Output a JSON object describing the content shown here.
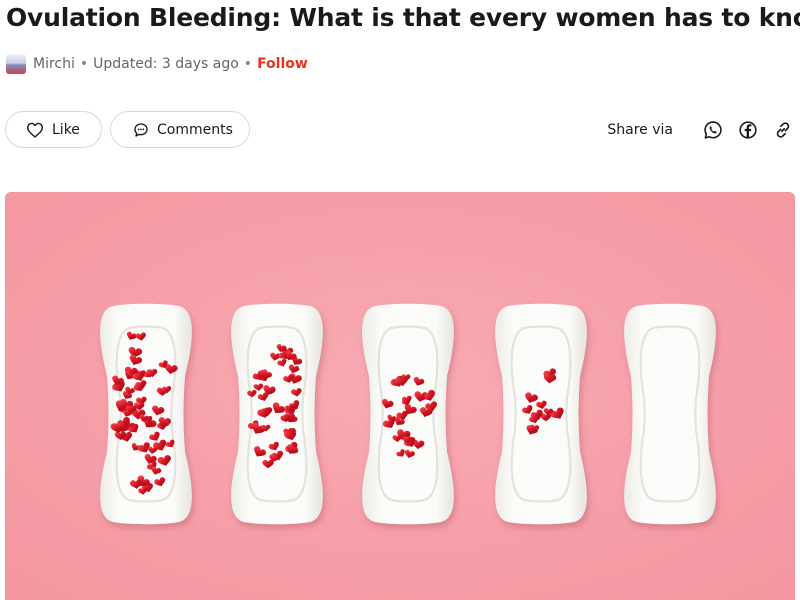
{
  "article": {
    "title": "Ovulation Bleeding: What is that every women has to know",
    "meta": {
      "author": "Mirchi",
      "separator": "•",
      "updated": "Updated: 3 days ago",
      "follow_label": "Follow"
    }
  },
  "actions": {
    "like_label": "Like",
    "comments_label": "Comments",
    "share_label": "Share via",
    "share_icons": [
      "whatsapp-icon",
      "facebook-icon",
      "link-icon"
    ]
  },
  "hero_image": {
    "subject": "five sanitary pads with decreasing amounts of red heart confetti on a pink background",
    "pad_count": 5,
    "hearts_per_pad": [
      60,
      42,
      24,
      12,
      0
    ],
    "background_color": "#f7a2ab",
    "pad_color": "#f9f9f7",
    "heart_color": "#c4101c"
  },
  "colors": {
    "accent": "#e8331f",
    "text": "#1a1a1a",
    "muted": "#666666",
    "border": "#d9d9d9"
  }
}
